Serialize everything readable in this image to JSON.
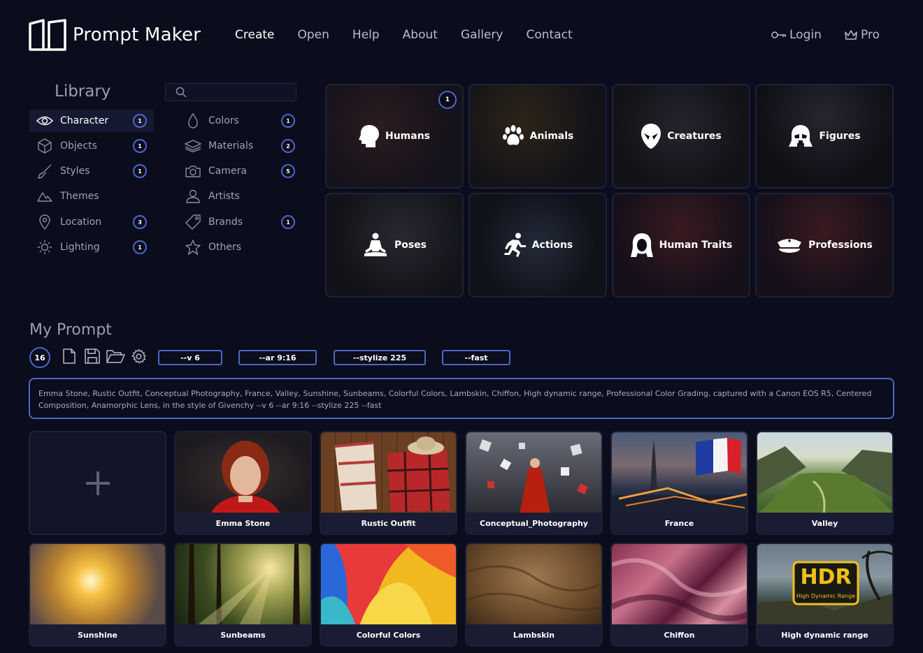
{
  "app": {
    "title": "Prompt Maker"
  },
  "nav": {
    "items": [
      "Create",
      "Open",
      "Help",
      "About",
      "Gallery",
      "Contact"
    ],
    "active": "Create"
  },
  "account": {
    "login": "Login",
    "pro": "Pro"
  },
  "library": {
    "title": "Library",
    "search_placeholder": "",
    "left": [
      {
        "label": "Character",
        "icon": "eye-icon",
        "count": "1",
        "active": true
      },
      {
        "label": "Objects",
        "icon": "cube-icon",
        "count": "1"
      },
      {
        "label": "Styles",
        "icon": "brush-icon",
        "count": "1"
      },
      {
        "label": "Themes",
        "icon": "mountain-icon",
        "count": ""
      },
      {
        "label": "Location",
        "icon": "map-pin-icon",
        "count": "3"
      },
      {
        "label": "Lighting",
        "icon": "sun-icon",
        "count": "1"
      }
    ],
    "right": [
      {
        "label": "Colors",
        "icon": "drop-icon",
        "count": "1"
      },
      {
        "label": "Materials",
        "icon": "layers-icon",
        "count": "2"
      },
      {
        "label": "Camera",
        "icon": "camera-icon",
        "count": "5"
      },
      {
        "label": "Artists",
        "icon": "person-icon",
        "count": ""
      },
      {
        "label": "Brands",
        "icon": "tag-icon",
        "count": "1"
      },
      {
        "label": "Others",
        "icon": "star-icon",
        "count": ""
      }
    ]
  },
  "categories": [
    {
      "label": "Humans",
      "icon": "head-icon",
      "count": "1"
    },
    {
      "label": "Animals",
      "icon": "paw-icon",
      "count": ""
    },
    {
      "label": "Creatures",
      "icon": "alien-icon",
      "count": ""
    },
    {
      "label": "Figures",
      "icon": "helmet-icon",
      "count": ""
    },
    {
      "label": "Poses",
      "icon": "meditation-icon",
      "count": ""
    },
    {
      "label": "Actions",
      "icon": "running-icon",
      "count": ""
    },
    {
      "label": "Human Traits",
      "icon": "woman-hair-icon",
      "count": ""
    },
    {
      "label": "Professions",
      "icon": "police-cap-icon",
      "count": ""
    }
  ],
  "my_prompt": {
    "title": "My Prompt",
    "count": "16",
    "params": [
      "--v 6",
      "--ar 9:16",
      "--stylize 225",
      "--fast"
    ],
    "text": "Emma Stone, Rustic Outfit, Conceptual Photography, France, Valley, Sunshine, Sunbeams, Colorful Colors, Lambskin, Chiffon, High dynamic range, Professional Color Grading, captured with a Canon EOS R5, Centered Composition, Anamorphic Lens, in the style of Givenchy --v 6 --ar 9:16 --stylize 225 --fast"
  },
  "cards": [
    {
      "label": "Emma Stone"
    },
    {
      "label": "Rustic Outfit"
    },
    {
      "label": "Conceptual_Photography"
    },
    {
      "label": "France"
    },
    {
      "label": "Valley"
    },
    {
      "label": "Sunshine"
    },
    {
      "label": "Sunbeams"
    },
    {
      "label": "Colorful Colors"
    },
    {
      "label": "Lambskin"
    },
    {
      "label": "Chiffon"
    },
    {
      "label": "High dynamic range"
    }
  ],
  "hdr_badge": {
    "big": "HDR",
    "small": "High Dynamic Range"
  },
  "colors": {
    "accent": "#4a68c8",
    "background": "#0b0c1c",
    "panel": "#191c33"
  }
}
